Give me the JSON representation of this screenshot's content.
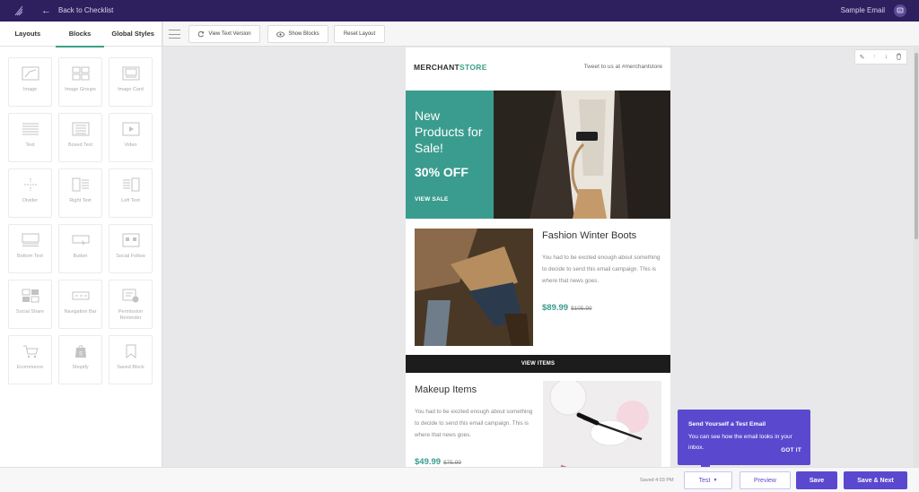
{
  "topbar": {
    "back_label": "Back to Checklist",
    "email_name": "Sample Email"
  },
  "left_panel": {
    "tabs": [
      {
        "label": "Layouts",
        "active": false
      },
      {
        "label": "Blocks",
        "active": true
      },
      {
        "label": "Global Styles",
        "active": false
      }
    ],
    "blocks": [
      {
        "label": "Image",
        "icon": "image-icon"
      },
      {
        "label": "Image Groups",
        "icon": "image-group-icon"
      },
      {
        "label": "Image Card",
        "icon": "image-card-icon"
      },
      {
        "label": "Text",
        "icon": "text-icon"
      },
      {
        "label": "Boxed Text",
        "icon": "boxed-text-icon"
      },
      {
        "label": "Video",
        "icon": "video-icon"
      },
      {
        "label": "Divider",
        "icon": "divider-icon"
      },
      {
        "label": "Right Text",
        "icon": "right-text-icon"
      },
      {
        "label": "Left Text",
        "icon": "left-text-icon"
      },
      {
        "label": "Bottom Text",
        "icon": "bottom-text-icon"
      },
      {
        "label": "Button",
        "icon": "button-icon"
      },
      {
        "label": "Social Follow",
        "icon": "social-follow-icon"
      },
      {
        "label": "Social Share",
        "icon": "social-share-icon"
      },
      {
        "label": "Navigation Bar",
        "icon": "navigation-bar-icon"
      },
      {
        "label": "Permission Reminder",
        "icon": "permission-reminder-icon"
      },
      {
        "label": "Ecommerce",
        "icon": "cart-icon"
      },
      {
        "label": "Shopify",
        "icon": "shopify-icon"
      },
      {
        "label": "Saved Block",
        "icon": "bookmark-icon"
      }
    ]
  },
  "toolbar": {
    "view_text_label": "View Text Version",
    "show_blocks_label": "Show Blocks",
    "reset_layout_label": "Reset Layout"
  },
  "email": {
    "brand_main": "MERCHANT",
    "brand_accent": "STORE",
    "tweet": "Tweet to us at #merchantstore",
    "hero": {
      "title": "New Products for Sale!",
      "discount": "30% OFF",
      "cta": "VIEW SALE"
    },
    "product1": {
      "title": "Fashion Winter Boots",
      "description": "You had to be excited enough about something to decide to send this email campaign. This is where that news goes.",
      "price": "$89.99",
      "old_price": "$105.99"
    },
    "view_items": "VIEW ITEMS",
    "product2": {
      "title": "Makeup Items",
      "description": "You had to be excited enough about something to decide to send this email campaign. This is where that news goes.",
      "price": "$49.99",
      "old_price": "$75.99"
    }
  },
  "tooltip": {
    "title": "Send Yourself a Test Email",
    "body": "You can see how the email looks in your inbox.",
    "action": "GOT IT"
  },
  "footer": {
    "saved": "Saved 4:03 PM",
    "test_label": "Test",
    "preview_label": "Preview",
    "save_label": "Save",
    "save_next_label": "Save & Next"
  },
  "colors": {
    "topbar": "#2e1f5e",
    "accent_teal": "#3a9c8e",
    "primary_purple": "#5a49cf"
  }
}
